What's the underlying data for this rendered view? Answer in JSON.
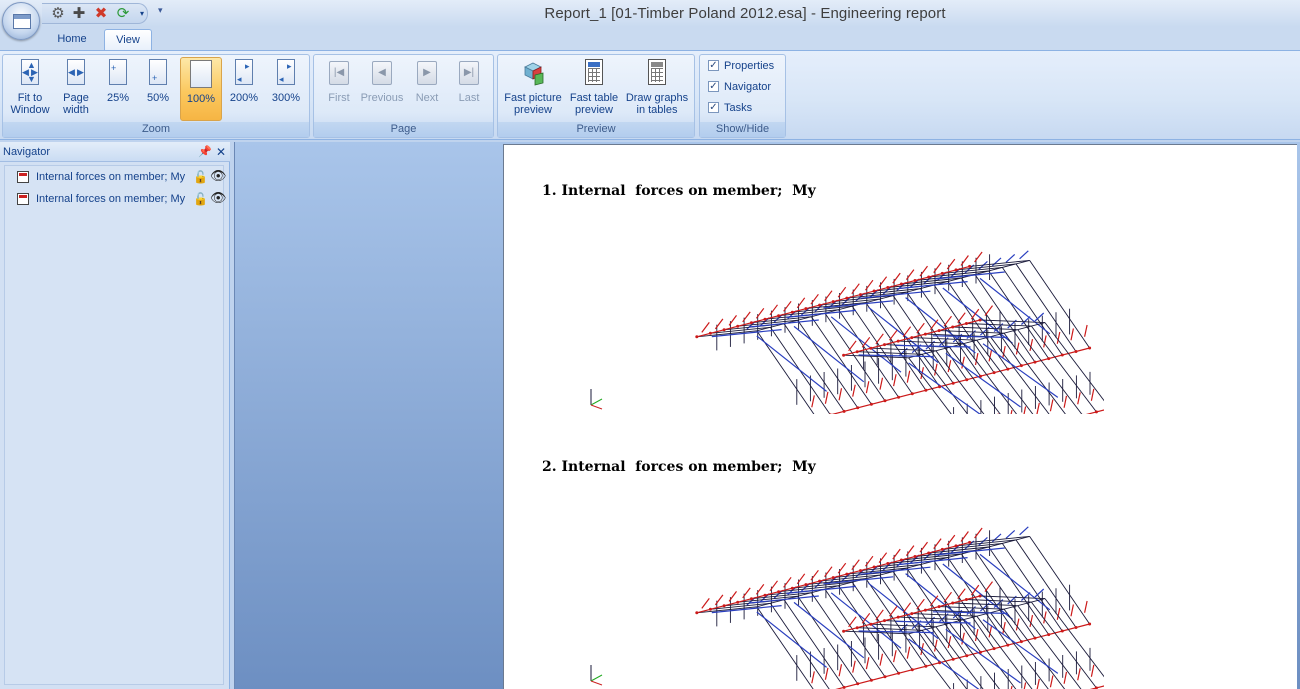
{
  "window": {
    "title": "Report_1 [01-Timber Poland 2012.esa] - Engineering report"
  },
  "quick_access": {
    "items": [
      {
        "name": "settings",
        "glyph": "⚙",
        "color": "#555555"
      },
      {
        "name": "add",
        "glyph": "✚",
        "color": "#4a4a4a"
      },
      {
        "name": "delete",
        "glyph": "✖",
        "color": "#d03a2a"
      },
      {
        "name": "refresh",
        "glyph": "⟳",
        "color": "#2e9a3a"
      }
    ]
  },
  "tabs": [
    {
      "label": "Home",
      "active": false
    },
    {
      "label": "View",
      "active": true
    }
  ],
  "ribbon": {
    "zoom": {
      "label": "Zoom",
      "buttons": [
        {
          "label1": "Fit to",
          "label2": "Window",
          "selected": false
        },
        {
          "label1": "Page",
          "label2": "width",
          "selected": false
        },
        {
          "label1": "25%",
          "label2": "",
          "selected": false
        },
        {
          "label1": "50%",
          "label2": "",
          "selected": false
        },
        {
          "label1": "100%",
          "label2": "",
          "selected": true
        },
        {
          "label1": "200%",
          "label2": "",
          "selected": false
        },
        {
          "label1": "300%",
          "label2": "",
          "selected": false
        }
      ]
    },
    "page": {
      "label": "Page",
      "buttons": [
        {
          "label": "First",
          "glyph": "|◀",
          "enabled": false
        },
        {
          "label": "Previous",
          "glyph": "◀",
          "enabled": false
        },
        {
          "label": "Next",
          "glyph": "▶",
          "enabled": false
        },
        {
          "label": "Last",
          "glyph": "▶|",
          "enabled": false
        }
      ]
    },
    "preview": {
      "label": "Preview",
      "buttons": [
        {
          "label1": "Fast picture",
          "label2": "preview"
        },
        {
          "label1": "Fast table",
          "label2": "preview"
        },
        {
          "label1": "Draw graphs",
          "label2": "in tables"
        }
      ]
    },
    "show_hide": {
      "label": "Show/Hide",
      "items": [
        {
          "label": "Properties",
          "checked": true
        },
        {
          "label": "Navigator",
          "checked": true
        },
        {
          "label": "Tasks",
          "checked": true
        }
      ]
    }
  },
  "navigator": {
    "title": "Navigator",
    "pin_glyph": "ᵖ",
    "close_glyph": "✕",
    "items": [
      {
        "label": "Internal forces on member; My"
      },
      {
        "label": "Internal forces on member; My"
      }
    ]
  },
  "report": {
    "sections": [
      {
        "title": "1. Internal  forces on member;  My"
      },
      {
        "title": "2. Internal  forces on member;  My"
      }
    ]
  },
  "colors": {
    "member": "#1a1a3a",
    "force_red": "#cc1a1a",
    "force_blue": "#2a3fbf",
    "axis_x": "#cc2222",
    "axis_y": "#22aa22"
  }
}
